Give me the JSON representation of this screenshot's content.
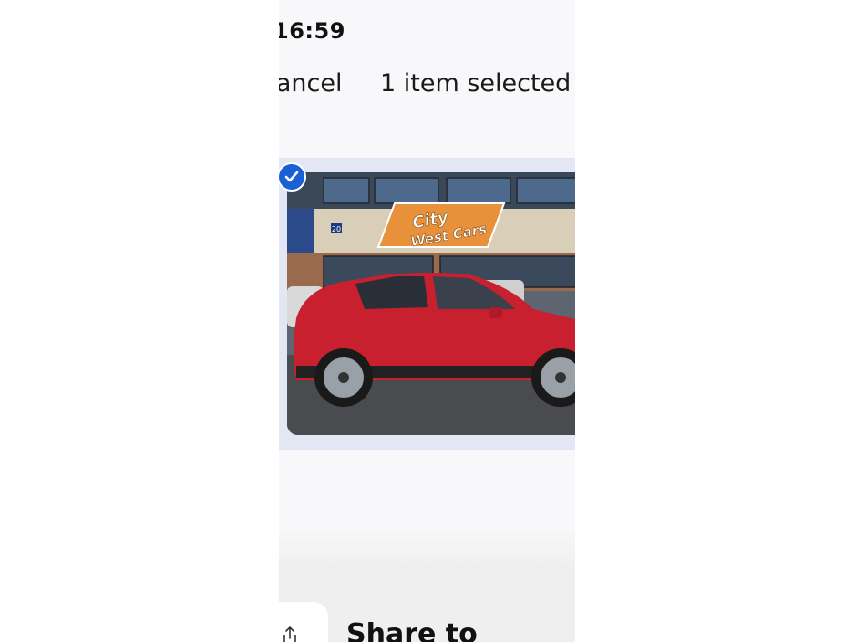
{
  "status_bar": {
    "time": "16:59"
  },
  "header": {
    "cancel_label": "Cancel",
    "title": "1 item selected"
  },
  "photo": {
    "sign_text_line1": "City",
    "sign_text_line2": "West Cars",
    "sign_number": "20",
    "selected": true
  },
  "share_sheet": {
    "share_label": "Share to"
  },
  "icons": {
    "check": "check-icon",
    "share": "share-icon"
  },
  "colors": {
    "accent": "#1a5fd6",
    "tile_bg": "#e3e6f3",
    "sign_orange": "#e8913a",
    "car_red": "#c8202e"
  }
}
